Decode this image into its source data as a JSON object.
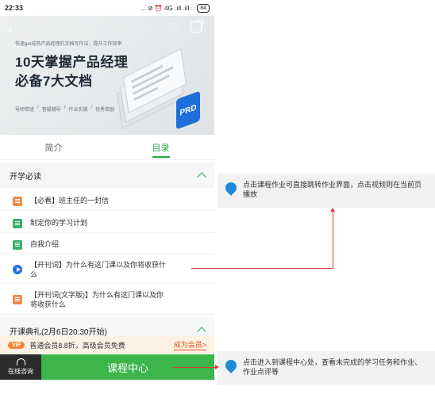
{
  "statusbar": {
    "time": "22:33",
    "icons": "... ⊘ ⏰ 4G .ıll .ıll ◌",
    "battery": "84"
  },
  "banner": {
    "subtitle": "快速get成熟产品经理的文档写作法，提升工作效率",
    "title_line1": "10天掌握产品经理",
    "title_line2": "必备7大文档",
    "tags": [
      "导师带班",
      "/",
      "答疑辅导",
      "/",
      "作业实操",
      "/",
      "优秀奖励"
    ],
    "badge": "PRD"
  },
  "tabs": [
    {
      "label": "简介"
    },
    {
      "label": "目录"
    }
  ],
  "sections": [
    {
      "title": "开学必读"
    },
    {
      "title": "开课典礼(2月6日20:30开始)"
    }
  ],
  "items": [
    {
      "label": "【必看】班主任的一封信",
      "icon": "document-icon"
    },
    {
      "label": "制定你的学习计划",
      "icon": "assignment-icon"
    },
    {
      "label": "自我介绍",
      "icon": "assignment-icon"
    },
    {
      "label_line1": "【开刊词】为什么有这门课以及你将收获什",
      "label_line2": "么",
      "icon": "play-icon"
    },
    {
      "label_line1": "【开刊词(文字版)】为什么有这门课以及你",
      "label_line2": "将收获什么",
      "icon": "document-icon"
    }
  ],
  "vip": {
    "badge": "VIP",
    "text": "普通会员8.8折，高级会员免费",
    "link": "成为会员>"
  },
  "bottom": {
    "consult": "在线咨询",
    "course_center": "课程中心"
  },
  "annotations": [
    {
      "text": "点击课程作业可直接跳转作业界面，点击视频则在当前页播放"
    },
    {
      "text": "点击进入到课程中心处，查看未完成的学习任务和作业、作业点评等"
    }
  ],
  "colors": {
    "accent": "#3cb54a",
    "annotation_line": "#e53935",
    "vip_orange": "#f0843c"
  }
}
